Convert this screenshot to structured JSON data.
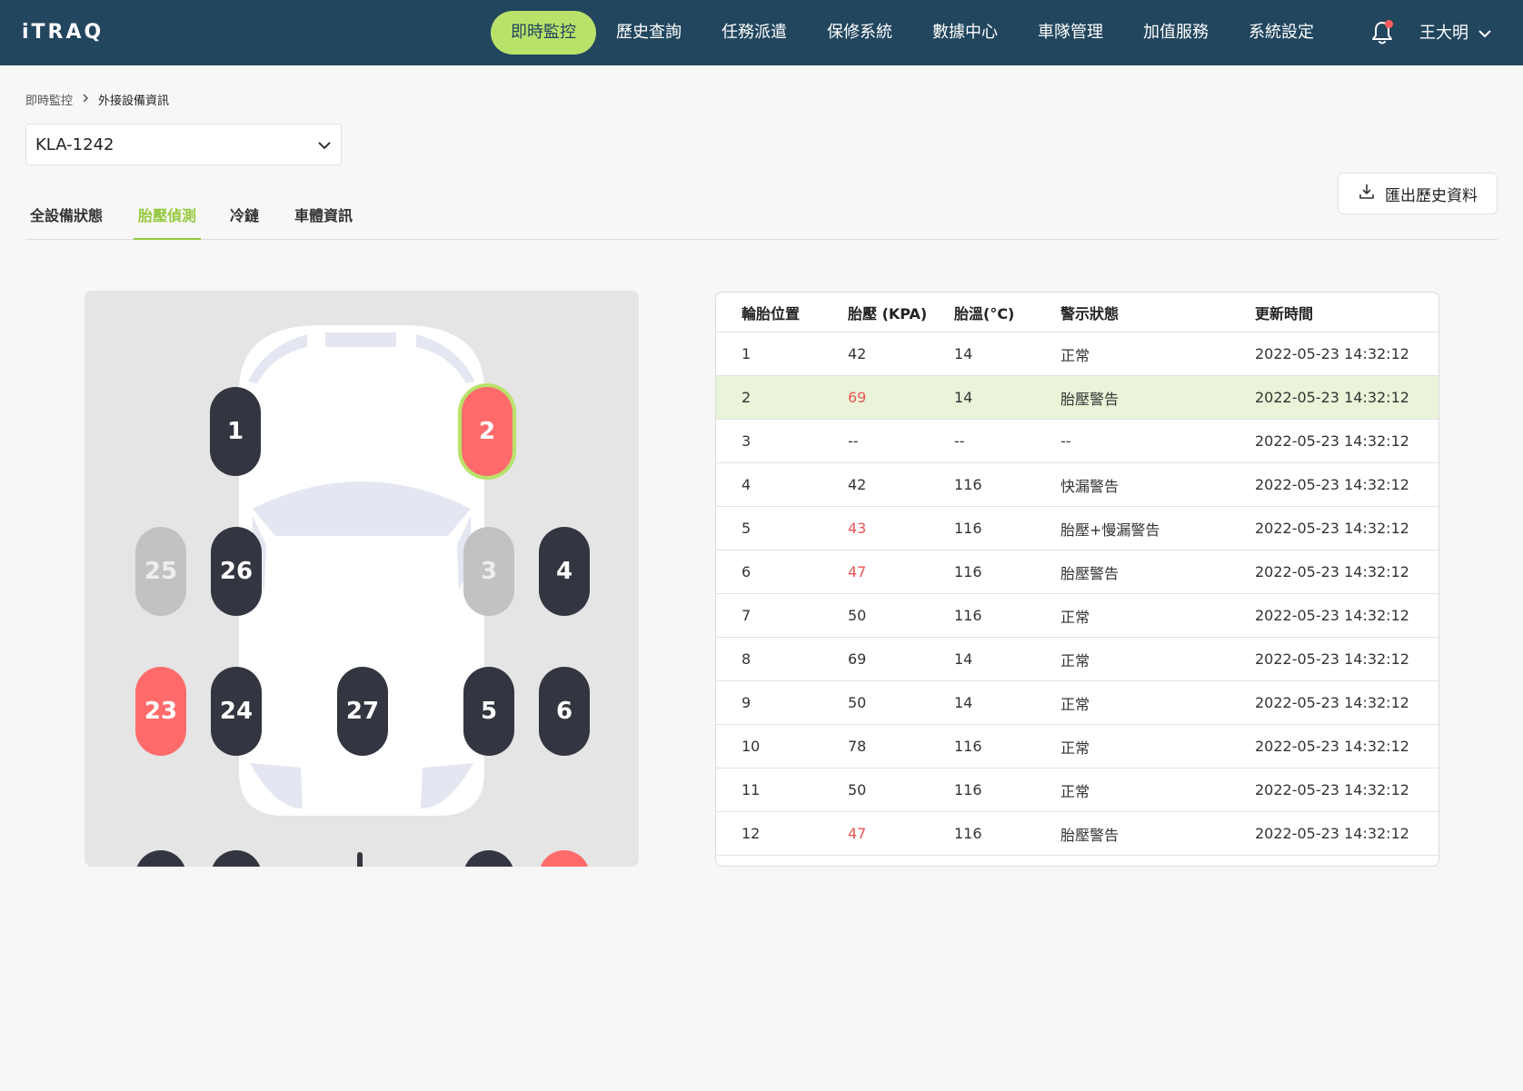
{
  "app": {
    "logo": "iTRAQ",
    "nav": [
      {
        "label": "即時監控",
        "active": true
      },
      {
        "label": "歷史查詢",
        "active": false
      },
      {
        "label": "任務派遣",
        "active": false
      },
      {
        "label": "保修系統",
        "active": false
      },
      {
        "label": "數據中心",
        "active": false
      },
      {
        "label": "車隊管理",
        "active": false
      },
      {
        "label": "加值服務",
        "active": false
      },
      {
        "label": "系統設定",
        "active": false
      }
    ],
    "user": "王大明",
    "accent": "#b9e26a",
    "header_bg": "#22465e"
  },
  "breadcrumb": [
    "即時監控",
    "外接設備資訊"
  ],
  "vehicle_select": {
    "value": "KLA-1242"
  },
  "tabs": [
    {
      "label": "全設備狀態",
      "active": false
    },
    {
      "label": "胎壓偵測",
      "active": true
    },
    {
      "label": "冷鏈",
      "active": false
    },
    {
      "label": "車體資訊",
      "active": false
    }
  ],
  "export_label": "匯出歷史資料",
  "tires": [
    {
      "id": "1",
      "status": "dark"
    },
    {
      "id": "2",
      "status": "red",
      "selected": true
    },
    {
      "id": "25",
      "status": "gray"
    },
    {
      "id": "26",
      "status": "dark"
    },
    {
      "id": "3",
      "status": "gray"
    },
    {
      "id": "4",
      "status": "dark"
    },
    {
      "id": "23",
      "status": "red"
    },
    {
      "id": "24",
      "status": "dark"
    },
    {
      "id": "27",
      "status": "dark"
    },
    {
      "id": "5",
      "status": "dark"
    },
    {
      "id": "6",
      "status": "dark"
    }
  ],
  "table": {
    "headers": [
      "輪胎位置",
      "胎壓 (KPA)",
      "胎溫(°C)",
      "警示狀態",
      "更新時間"
    ],
    "rows": [
      {
        "pos": "1",
        "kpa": "42",
        "temp": "14",
        "status": "正常",
        "time": "2022-05-23  14:32:12",
        "warn": false
      },
      {
        "pos": "2",
        "kpa": "69",
        "temp": "14",
        "status": "胎壓警告",
        "time": "2022-05-23  14:32:12",
        "warn": true,
        "highlight": true
      },
      {
        "pos": "3",
        "kpa": "--",
        "temp": "--",
        "status": "--",
        "time": "2022-05-23  14:32:12",
        "warn": false
      },
      {
        "pos": "4",
        "kpa": "42",
        "temp": "116",
        "status": "快漏警告",
        "time": "2022-05-23  14:32:12",
        "warn": false
      },
      {
        "pos": "5",
        "kpa": "43",
        "temp": "116",
        "status": "胎壓+慢漏警告",
        "time": "2022-05-23  14:32:12",
        "warn": true
      },
      {
        "pos": "6",
        "kpa": "47",
        "temp": "116",
        "status": "胎壓警告",
        "time": "2022-05-23  14:32:12",
        "warn": true
      },
      {
        "pos": "7",
        "kpa": "50",
        "temp": "116",
        "status": "正常",
        "time": "2022-05-23  14:32:12",
        "warn": false
      },
      {
        "pos": "8",
        "kpa": "69",
        "temp": "14",
        "status": "正常",
        "time": "2022-05-23  14:32:12",
        "warn": false
      },
      {
        "pos": "9",
        "kpa": "50",
        "temp": "14",
        "status": "正常",
        "time": "2022-05-23  14:32:12",
        "warn": false
      },
      {
        "pos": "10",
        "kpa": "78",
        "temp": "116",
        "status": "正常",
        "time": "2022-05-23  14:32:12",
        "warn": false
      },
      {
        "pos": "11",
        "kpa": "50",
        "temp": "116",
        "status": "正常",
        "time": "2022-05-23  14:32:12",
        "warn": false
      },
      {
        "pos": "12",
        "kpa": "47",
        "temp": "116",
        "status": "胎壓警告",
        "time": "2022-05-23  14:32:12",
        "warn": true
      }
    ]
  }
}
